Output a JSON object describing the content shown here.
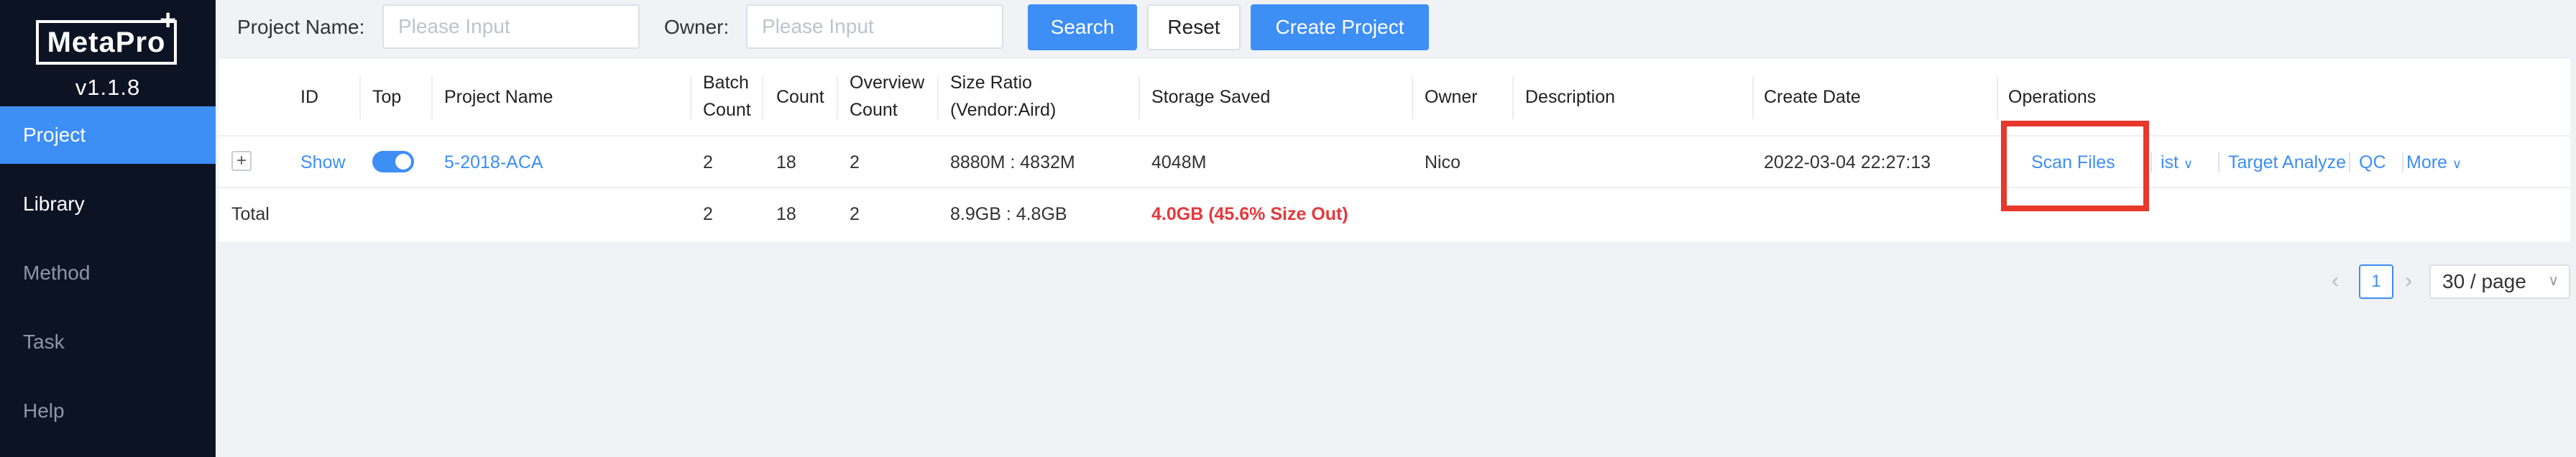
{
  "app": {
    "logo_text": "MetaPro",
    "logo_plus": "+",
    "version": "v1.1.8"
  },
  "sidebar": {
    "items": [
      {
        "label": "Project",
        "active": true
      },
      {
        "label": "Library"
      },
      {
        "label": "Method"
      },
      {
        "label": "Task"
      },
      {
        "label": "Help"
      }
    ]
  },
  "filters": {
    "project_name_label": "Project Name:",
    "project_name_placeholder": "Please Input",
    "owner_label": "Owner:",
    "owner_placeholder": "Please Input",
    "search_label": "Search",
    "reset_label": "Reset",
    "create_label": "Create Project"
  },
  "table": {
    "headers": {
      "id": "ID",
      "top": "Top",
      "project_name": "Project Name",
      "batch_count_1": "Batch",
      "batch_count_2": "Count",
      "count": "Count",
      "overview_count_1": "Overview",
      "overview_count_2": "Count",
      "size_ratio_1": "Size Ratio",
      "size_ratio_2": "(Vendor:Aird)",
      "storage_saved": "Storage Saved",
      "owner": "Owner",
      "description": "Description",
      "create_date": "Create Date",
      "operations": "Operations"
    },
    "rows": [
      {
        "expand": "+",
        "id": "Show",
        "top": true,
        "project_name": "5-2018-ACA",
        "batch_count": "2",
        "count": "18",
        "overview_count": "2",
        "size_ratio": "8880M : 4832M",
        "storage_saved": "4048M",
        "owner": "Nico",
        "description": "",
        "create_date": "2022-03-04 22:27:13",
        "operations": {
          "scan_files": "Scan Files",
          "list": "ist",
          "target_analyze": "Target Analyze",
          "qc": "QC",
          "more": "More"
        }
      }
    ],
    "total": {
      "label": "Total",
      "batch_count": "2",
      "count": "18",
      "overview_count": "2",
      "size_ratio": "8.9GB : 4.8GB",
      "storage_saved": "4.0GB (45.6% Size Out)"
    }
  },
  "pagination": {
    "current_page": "1",
    "page_size": "30 / page"
  },
  "colors": {
    "primary": "#3d8ef5",
    "sidebar_bg": "#0c1424",
    "danger": "#e4393c",
    "highlight": "#e8372b"
  }
}
